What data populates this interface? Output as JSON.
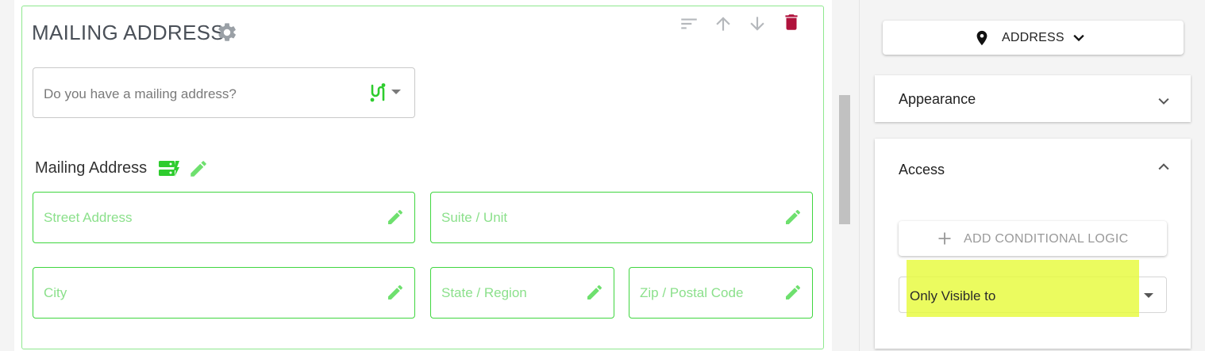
{
  "section": {
    "title": "MAILING ADDRESS",
    "mailing_question": {
      "placeholder": "Do you have a mailing address?"
    },
    "group_label": "Mailing Address",
    "fields": {
      "street": "Street Address",
      "suite": "Suite / Unit",
      "city": "City",
      "state": "State / Region",
      "zip": "Zip / Postal Code"
    },
    "toolbar_icons": [
      "sort-icon",
      "arrow-up-icon",
      "arrow-down-icon",
      "delete-icon"
    ]
  },
  "right_panel": {
    "element_type_button": "ADDRESS",
    "appearance": {
      "title": "Appearance"
    },
    "access": {
      "title": "Access",
      "add_conditional_logic": "ADD CONDITIONAL LOGIC",
      "visibility_select": {
        "value": "Only Visible to"
      }
    }
  },
  "colors": {
    "field_border": "#3fd63f",
    "field_label": "#8be08b",
    "delete_red": "#b0123c",
    "highlight": "#e6fa3c"
  }
}
